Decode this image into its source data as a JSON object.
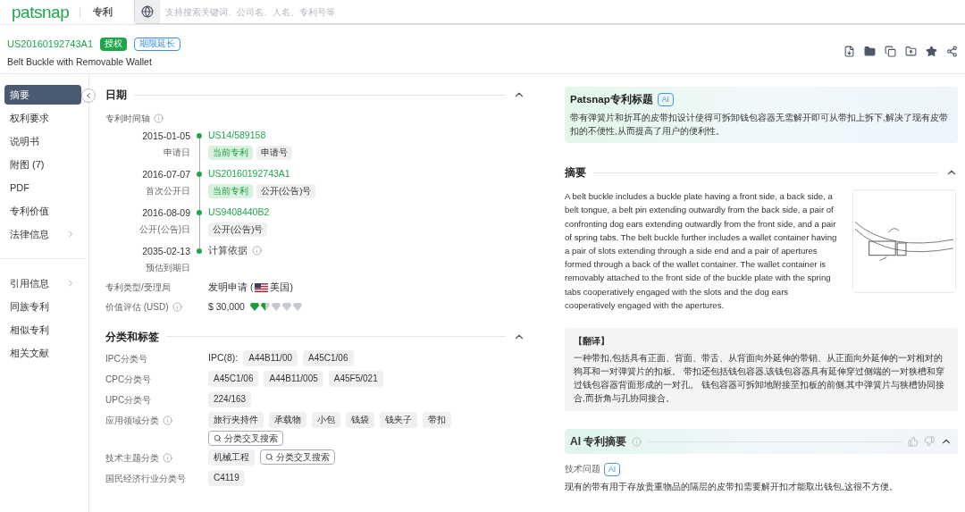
{
  "header": {
    "logo": "patsnap",
    "section": "专利",
    "search": {
      "placeholder": "支持搜索关键词、公司名、人名、专利号等"
    }
  },
  "patent": {
    "number": "US20160192743A1",
    "badges": [
      {
        "label": "授权",
        "kind": "solid"
      },
      {
        "label": "期限延长",
        "kind": "outline"
      }
    ],
    "title": "Belt Buckle with Removable Wallet"
  },
  "sidebar": {
    "items": [
      {
        "label": "摘要",
        "selected": true,
        "has_arrow": false
      },
      {
        "label": "权利要求",
        "selected": false,
        "has_arrow": false
      },
      {
        "label": "说明书",
        "selected": false,
        "has_arrow": false
      },
      {
        "label": "附图 (7)",
        "selected": false,
        "has_arrow": false
      },
      {
        "label": "PDF",
        "selected": false,
        "has_arrow": false
      },
      {
        "label": "专利价值",
        "selected": false,
        "has_arrow": false
      },
      {
        "label": "法律信息",
        "selected": false,
        "has_arrow": true
      }
    ],
    "items_2": [
      {
        "label": "引用信息",
        "selected": false,
        "has_arrow": true
      },
      {
        "label": "同族专利",
        "selected": false,
        "has_arrow": false
      },
      {
        "label": "相似专利",
        "selected": false,
        "has_arrow": false
      },
      {
        "label": "相关文献",
        "selected": false,
        "has_arrow": false
      }
    ]
  },
  "dates": {
    "title": "日期",
    "timeline_label": "专利时间轴",
    "timeline": [
      {
        "date": "2015-01-05",
        "date_label": "申请日",
        "number": "US14/589158",
        "kind": "link",
        "tags": [
          {
            "label": "当前专利",
            "kind": "current"
          },
          {
            "label": "申请号",
            "kind": "normal"
          }
        ]
      },
      {
        "date": "2016-07-07",
        "date_label": "首次公开日",
        "number": "US20160192743A1",
        "kind": "link",
        "tags": [
          {
            "label": "当前专利",
            "kind": "current"
          },
          {
            "label": "公开(公告)号",
            "kind": "normal"
          }
        ]
      },
      {
        "date": "2016-08-09",
        "date_label": "公开(公告)日",
        "number": "US9408440B2",
        "kind": "link",
        "tags": [
          {
            "label": "公开(公告)号",
            "kind": "normal"
          }
        ]
      },
      {
        "date": "2035-02-13",
        "date_label": "预估到期日",
        "number": "计算依据",
        "kind": "info"
      }
    ],
    "type_label": "专利类型/受理局",
    "type_value": "发明申请 (",
    "country": "美国",
    "country_close": ")",
    "value_label": "价值评估 (USD)",
    "value": "$ 30,000",
    "stars": 1.5
  },
  "classification": {
    "title": "分类和标签",
    "rows": [
      {
        "label": "IPC分类号",
        "info": false,
        "prefix": "IPC(8):",
        "tags": [
          "A44B11/00",
          "A45C1/06"
        ],
        "search_button": null
      },
      {
        "label": "CPC分类号",
        "info": false,
        "tags": [
          "A45C1/06",
          "A44B11/005",
          "A45F5/021"
        ],
        "search_button": null
      },
      {
        "label": "UPC分类号",
        "info": false,
        "tags": [
          "224/163"
        ],
        "search_button": null
      },
      {
        "label": "应用领域分类",
        "info": true,
        "tags": [
          "旅行夹持件",
          "承载物",
          "小包",
          "钱袋",
          "钱夹子",
          "带扣"
        ],
        "search_button": "分类交叉搜索"
      },
      {
        "label": "技术主题分类",
        "info": true,
        "tags": [
          "机械工程"
        ],
        "search_button": "分类交叉搜索"
      },
      {
        "label": "国民经济行业分类号",
        "info": false,
        "tags": [
          "C4119"
        ],
        "search_button": null
      }
    ]
  },
  "ai_title": {
    "title": "Patsnap专利标题",
    "badge": "AI",
    "text": "带有弹簧片和折耳的皮带扣设计使得可拆卸钱包容器无需解开即可从带扣上拆下,解决了现有皮带扣的不便性,从而提高了用户的便利性。"
  },
  "abstract": {
    "title": "摘要",
    "text": "A belt buckle includes a buckle plate having a front side, a back side, a belt tongue, a belt pin extending outwardly from the back side, a pair of confronting dog ears extending outwardly from the front side, and a pair of spring tabs. The belt buckle further includes a wallet container having a pair of slots extending through a side end and a pair of apertures formed through a back of the wallet container. The wallet container is removably attached to the front side of the buckle plate with the spring tabs cooperatively engaged with the slots and the dog ears cooperatively engaged with the apertures.",
    "translation_title": "【翻译】",
    "translation": "一种带扣,包括具有正面、背面、带舌、从背面向外延伸的带销、从正面向外延伸的一对相对的狗耳和一对弹簧片的扣板。 带扣还包括钱包容器,该钱包容器具有延伸穿过侧端的一对狭槽和穿过钱包容器背面形成的一对孔。 钱包容器可拆卸地附接至扣板的前侧,其中弹簧片与狭槽协同接合,而折角与孔协同接合。"
  },
  "ai_summary": {
    "title": "AI 专利摘要",
    "question_label": "技术问题",
    "badge": "AI",
    "text": "现有的带有用于存放贵重物品的隔层的皮带扣需要解开扣才能取出钱包,这很不方便。"
  }
}
